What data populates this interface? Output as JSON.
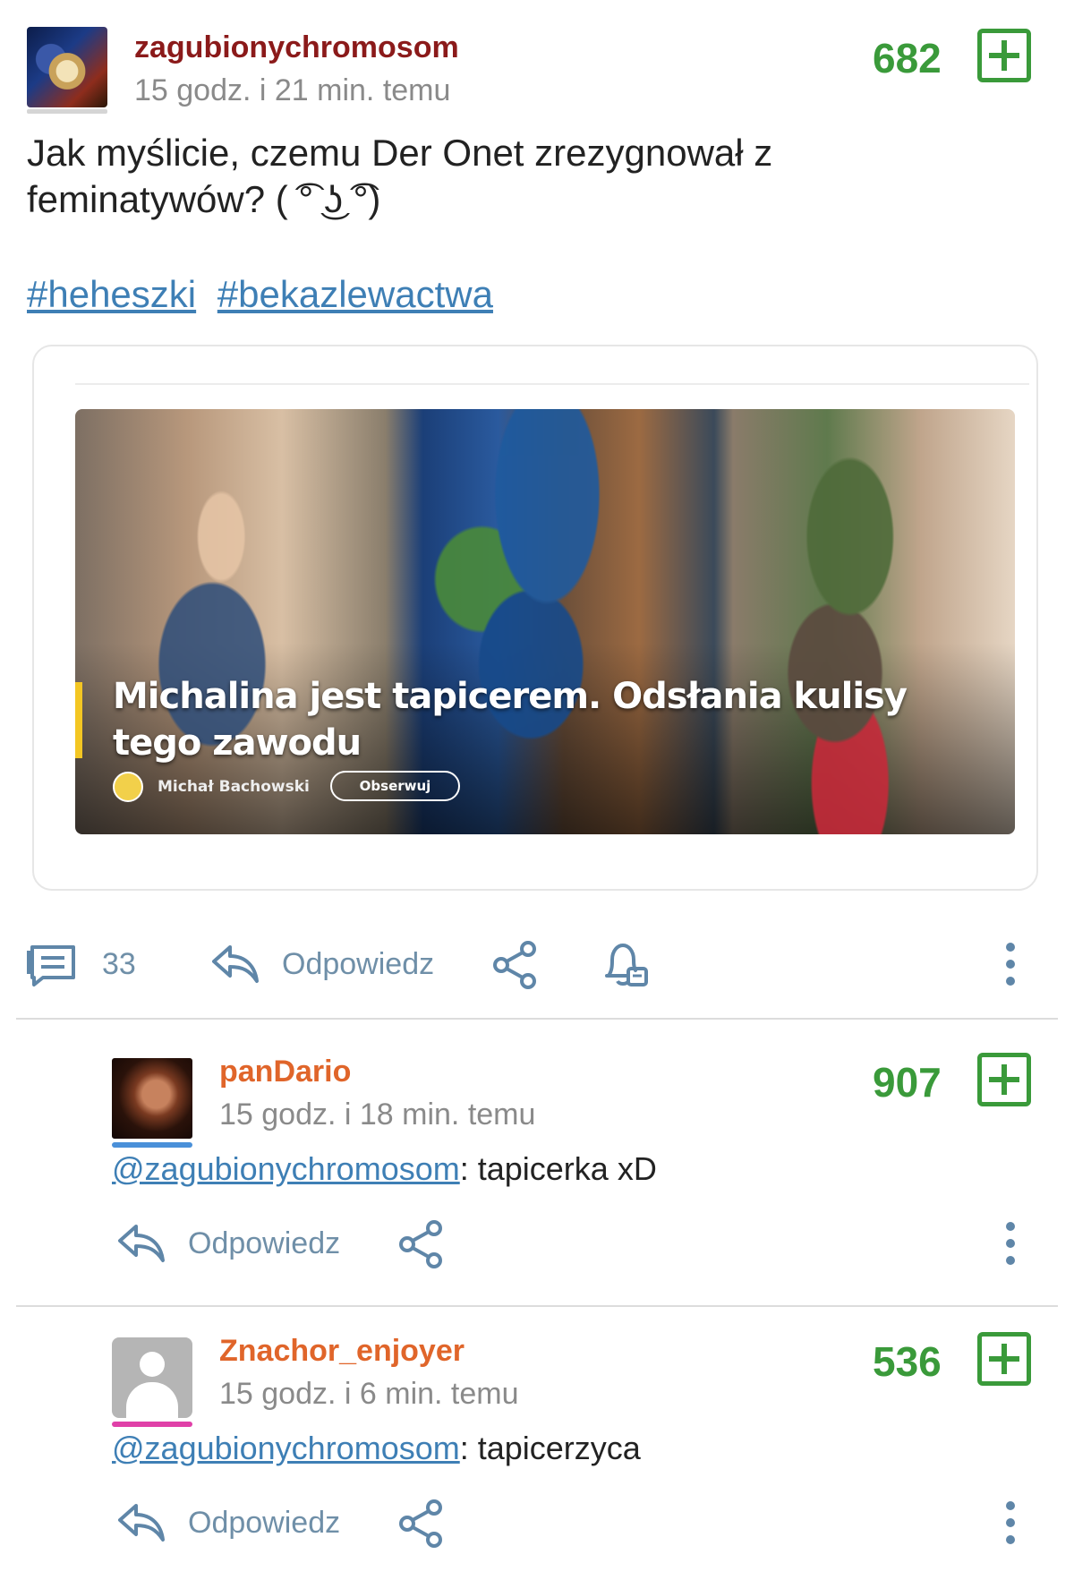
{
  "post": {
    "username": "zagubionychromosom",
    "time": "15 godz. i 21 min. temu",
    "votes": "682",
    "text_line1": "Jak myślicie, czemu Der Onet zrezygnował z",
    "text_line2": "feminatywów? ( ͡° ͜ʖ ͡°)",
    "tags": [
      "#heheszki",
      "#bekazlewactwa"
    ],
    "embed": {
      "headline_line1": "Michalina jest tapicerem. Odsłania kulisy",
      "headline_line2": "tego zawodu",
      "author": "Michał Bachowski",
      "follow_label": "Obserwuj"
    },
    "comments_count": "33",
    "reply_label": "Odpowiedz"
  },
  "comments": [
    {
      "username": "panDario",
      "time": "15 godz. i 18 min. temu",
      "votes": "907",
      "mention": "@zagubionychromosom",
      "text": ": tapicerka xD",
      "reply_label": "Odpowiedz"
    },
    {
      "username": "Znachor_enjoyer",
      "time": "15 godz. i 6 min. temu",
      "votes": "536",
      "mention": "@zagubionychromosom",
      "text": ": tapicerzyca",
      "reply_label": "Odpowiedz"
    }
  ],
  "colors": {
    "vote_green": "#3a9a3a",
    "op_username": "#8b1a1a",
    "comment_username": "#e0652a",
    "link_blue": "#3e7fb5",
    "icon_blue": "#5f86a8"
  },
  "icons": [
    "comments-icon",
    "reply-icon",
    "share-icon",
    "notification-bell-icon",
    "more-options-icon",
    "plus-vote-icon"
  ]
}
